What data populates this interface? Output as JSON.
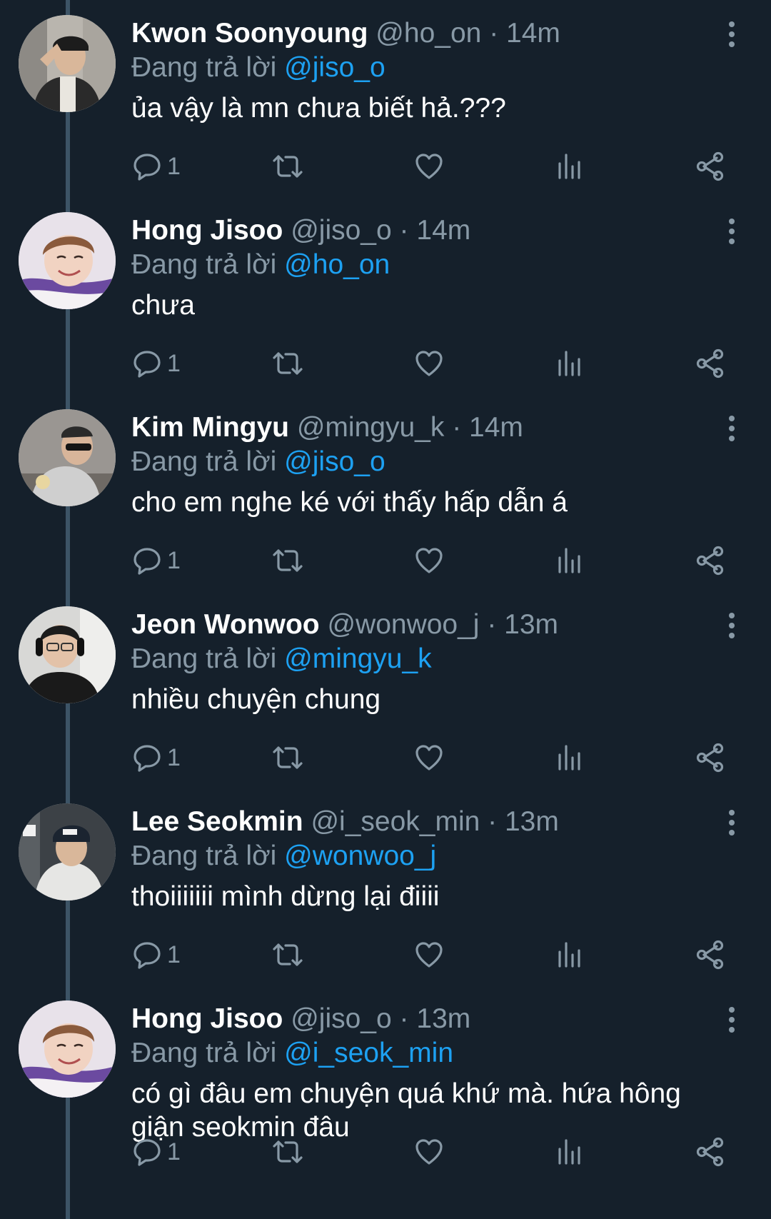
{
  "tweets": [
    {
      "name": "Kwon Soonyoung",
      "handle": "@ho_on",
      "time": "14m",
      "reply_prefix": "Đang trả lời",
      "reply_to": "@jiso_o",
      "text": "ủa vậy là mn chưa biết hả.???",
      "reply_count": "1",
      "avatar": "avatar-kwon"
    },
    {
      "name": "Hong Jisoo",
      "handle": "@jiso_o",
      "time": "14m",
      "reply_prefix": "Đang trả lời",
      "reply_to": "@ho_on",
      "text": "chưa",
      "reply_count": "1",
      "avatar": "avatar-hong"
    },
    {
      "name": "Kim Mingyu",
      "handle": "@mingyu_k",
      "time": "14m",
      "reply_prefix": "Đang trả lời",
      "reply_to": "@jiso_o",
      "text": "cho em nghe ké với thấy hấp dẫn á",
      "reply_count": "1",
      "avatar": "avatar-kim"
    },
    {
      "name": "Jeon Wonwoo",
      "handle": "@wonwoo_j",
      "time": "13m",
      "reply_prefix": "Đang trả lời",
      "reply_to": "@mingyu_k",
      "text": "nhiều chuyện chung",
      "reply_count": "1",
      "avatar": "avatar-jeon"
    },
    {
      "name": "Lee Seokmin",
      "handle": "@i_seok_min",
      "time": "13m",
      "reply_prefix": "Đang trả lời",
      "reply_to": "@wonwoo_j",
      "text": "thoiiiiiii mình dừng lại điiii",
      "reply_count": "1",
      "avatar": "avatar-lee"
    },
    {
      "name": "Hong Jisoo",
      "handle": "@jiso_o",
      "time": "13m",
      "reply_prefix": "Đang trả lời",
      "reply_to": "@i_seok_min",
      "text": "có gì đâu em chuyện quá khứ mà. hứa hông giận seokmin đâu",
      "reply_count": "1",
      "avatar": "avatar-hong"
    }
  ],
  "separator": "·",
  "icons": {
    "reply": "reply-icon",
    "retweet": "retweet-icon",
    "like": "heart-icon",
    "analytics": "analytics-icon",
    "share": "share-icon",
    "more": "more-vertical-icon"
  },
  "colors": {
    "background": "#15202b",
    "name": "#ffffff",
    "secondary": "#8899a6",
    "mention": "#1da1f2",
    "thread_line": "#3d5466"
  }
}
